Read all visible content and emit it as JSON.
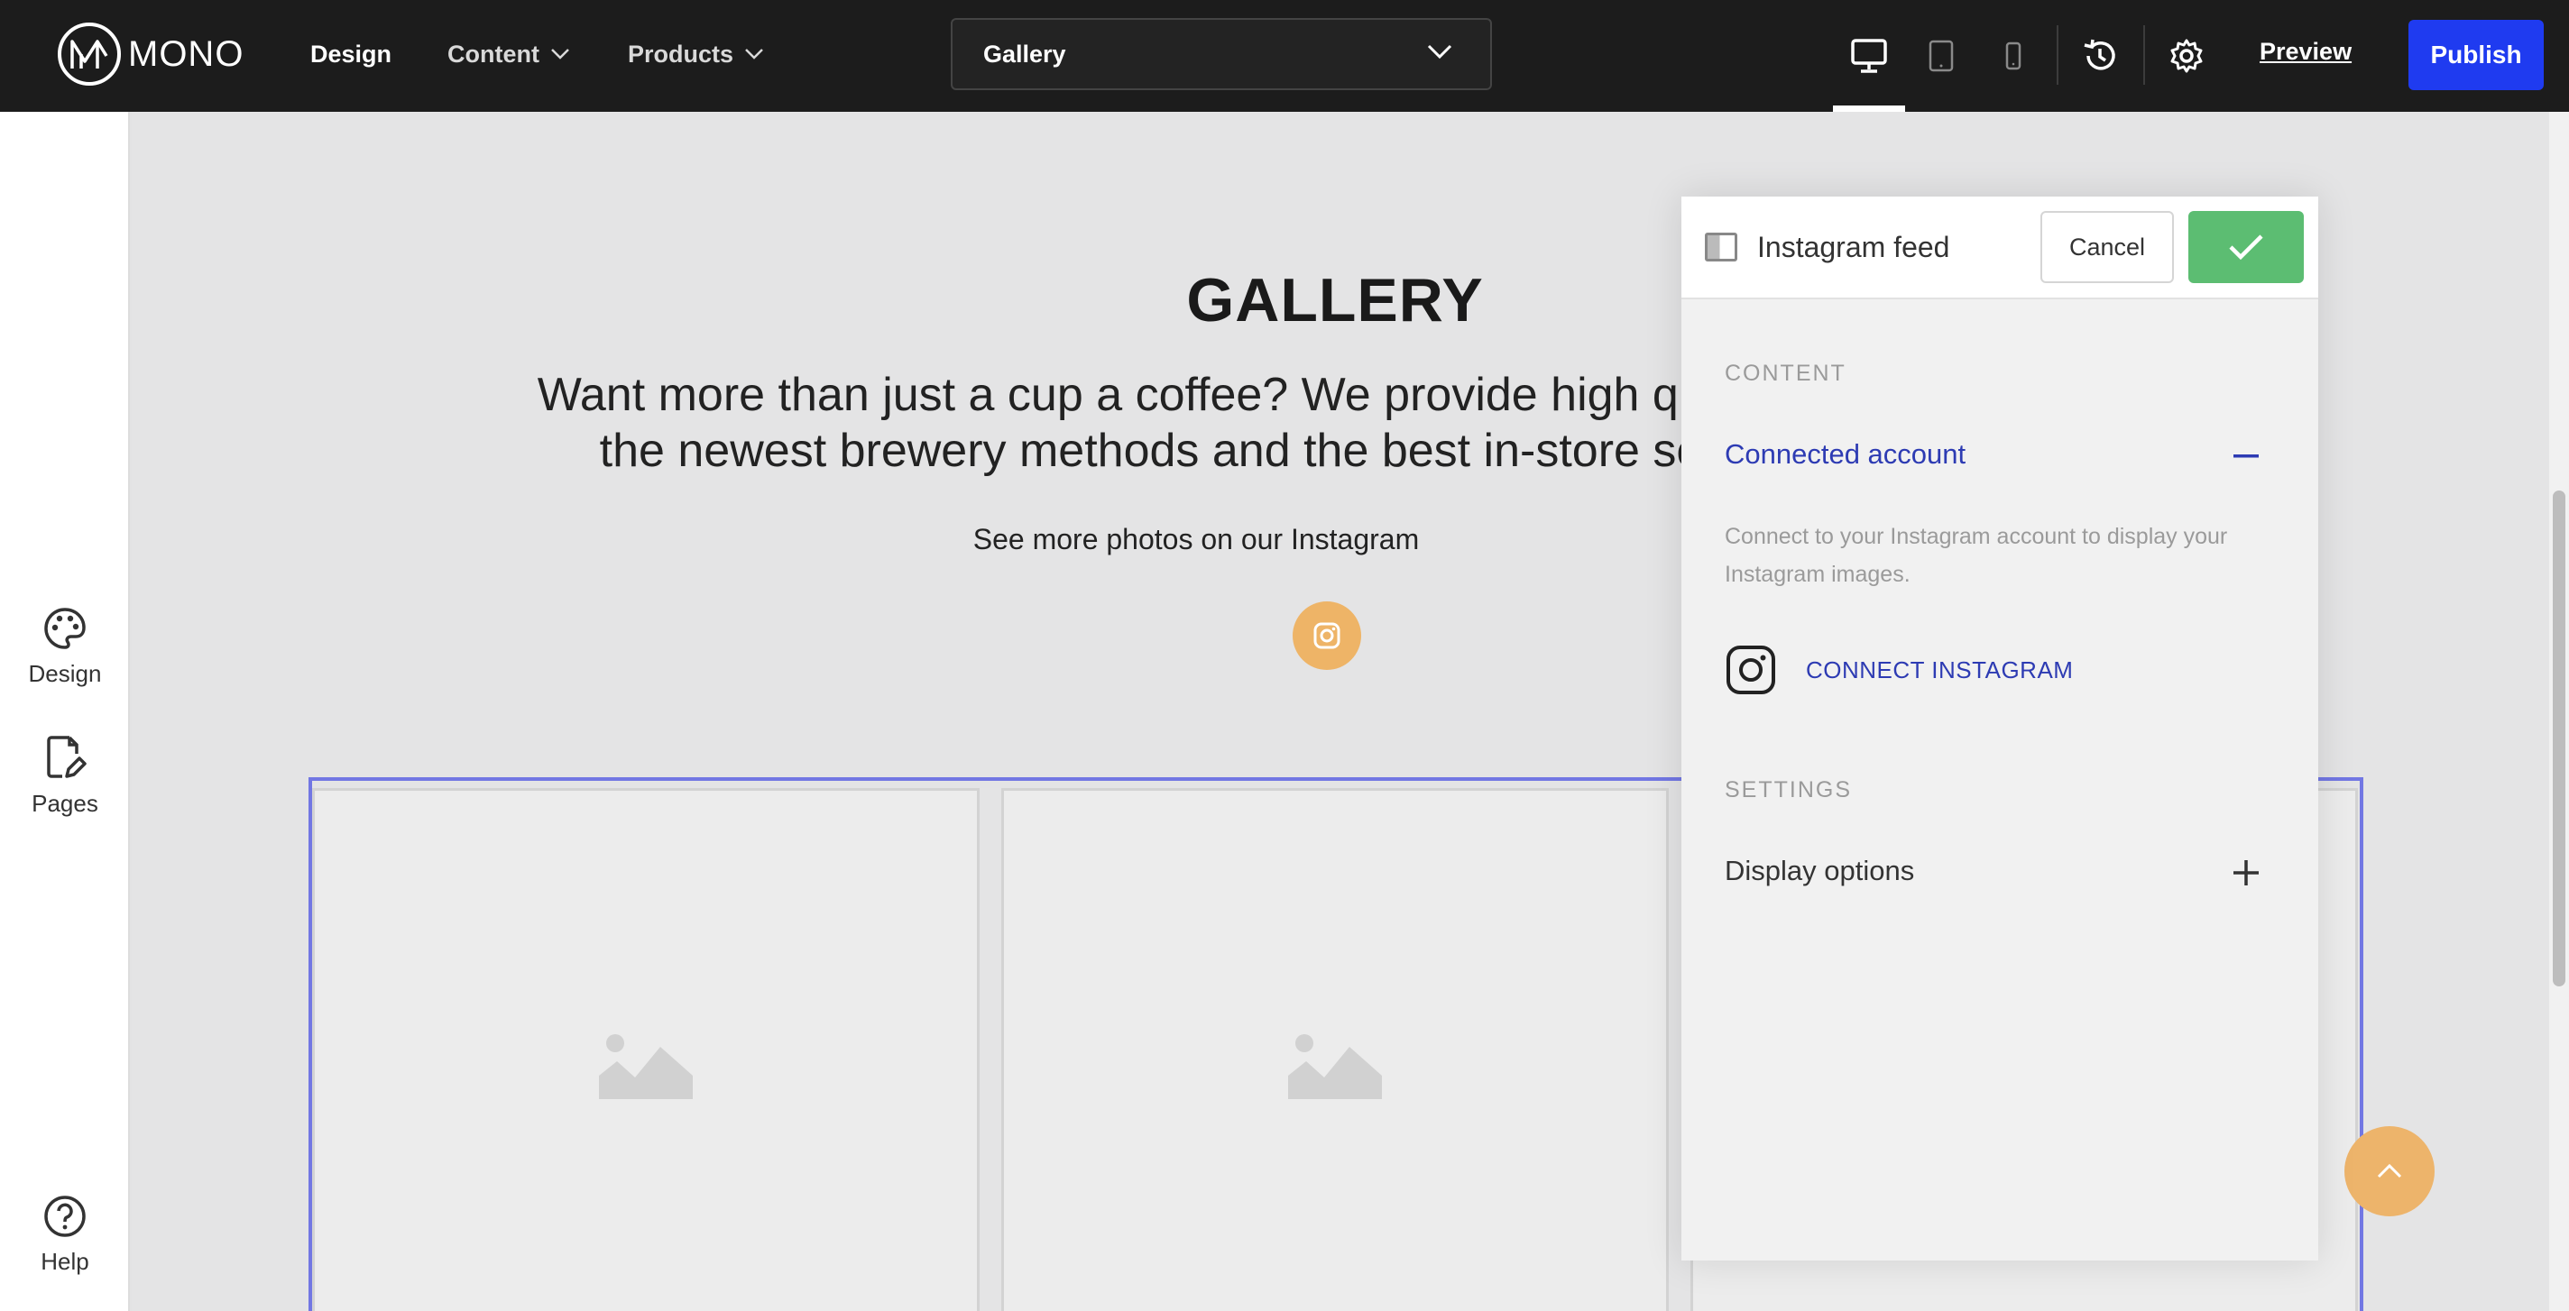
{
  "app": {
    "logo_text": "MONO",
    "nav": [
      {
        "label": "Design",
        "active": true
      },
      {
        "label": "Content",
        "has_dropdown": true
      },
      {
        "label": "Products",
        "has_dropdown": true
      }
    ],
    "page_select": {
      "value": "Gallery"
    },
    "devices": [
      "desktop",
      "tablet",
      "mobile"
    ],
    "preview_label": "Preview",
    "publish_label": "Publish",
    "colors": {
      "topbar": "#1c1c1c",
      "publish": "#1f3bf0",
      "accent": "#2d3bb3",
      "confirm": "#5cbd72",
      "selection": "#7277e3",
      "ig_accent": "#eeb467"
    }
  },
  "sidebar": {
    "items": [
      {
        "label": "Design",
        "icon": "palette-icon"
      },
      {
        "label": "Pages",
        "icon": "page-edit-icon"
      }
    ],
    "help_label": "Help"
  },
  "canvas": {
    "title": "GALLERY",
    "subtitle_line1": "Want more than just a cup a coffee? We provide high qualit",
    "subtitle_line2": "the newest brewery methods and the best in-store se",
    "more_text": "See more photos on our Instagram"
  },
  "panel": {
    "title": "Instagram feed",
    "cancel_label": "Cancel",
    "content_section": "CONTENT",
    "connected_account": {
      "title": "Connected account",
      "description": "Connect to your Instagram account to display your Instagram images.",
      "connect_label": "CONNECT INSTAGRAM",
      "expanded": true
    },
    "settings_section": "SETTINGS",
    "display_options": {
      "title": "Display options",
      "expanded": false
    }
  }
}
